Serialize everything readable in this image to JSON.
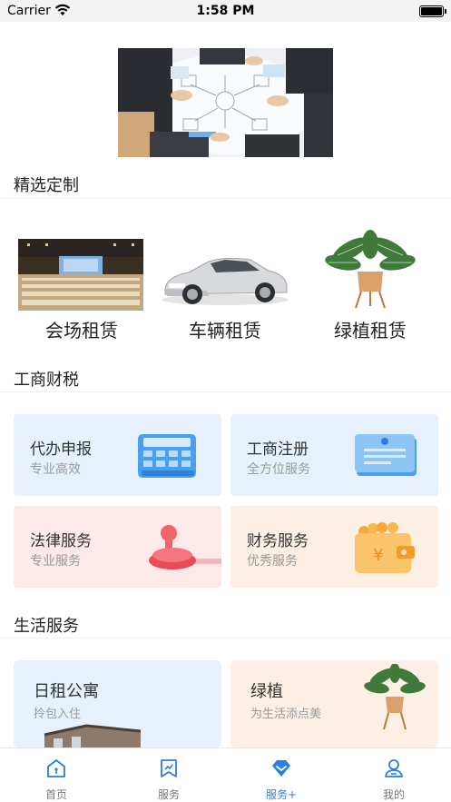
{
  "status_bar": {
    "carrier": "Carrier",
    "time": "1:58 PM"
  },
  "sections": {
    "featured": "精选定制",
    "business": "工商财税",
    "life": "生活服务"
  },
  "featured_items": [
    {
      "label": "会场租赁"
    },
    {
      "label": "车辆租赁"
    },
    {
      "label": "绿植租赁"
    }
  ],
  "business_cards": [
    {
      "title": "代办申报",
      "subtitle": "专业高效"
    },
    {
      "title": "工商注册",
      "subtitle": "全方位服务"
    },
    {
      "title": "法律服务",
      "subtitle": "专业服务"
    },
    {
      "title": "财务服务",
      "subtitle": "优秀服务"
    }
  ],
  "life_cards": [
    {
      "title": "日租公寓",
      "subtitle": "拎包入住"
    },
    {
      "title": "绿植",
      "subtitle": "为生活添点美"
    }
  ],
  "tabs": [
    {
      "label": "首页",
      "icon": "home-icon"
    },
    {
      "label": "服务",
      "icon": "bookmark-icon"
    },
    {
      "label": "服务+",
      "icon": "diamond-icon",
      "active": true
    },
    {
      "label": "我的",
      "icon": "user-icon"
    }
  ],
  "colors": {
    "accent": "#2b7fe0",
    "card_blue": "#e6f1fd",
    "card_pink": "#fde8ea",
    "card_peach": "#fdefe3"
  }
}
